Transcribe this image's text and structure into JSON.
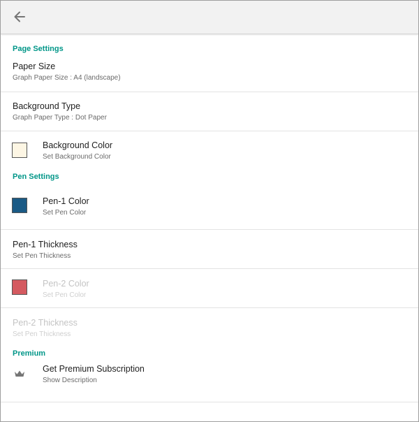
{
  "page_settings": {
    "header": "Page Settings",
    "paper_size": {
      "title": "Paper Size",
      "summary": "Graph Paper Size : A4 (landscape)"
    },
    "background_type": {
      "title": "Background Type",
      "summary": "Graph Paper Type : Dot Paper"
    },
    "background_color": {
      "title": "Background Color",
      "summary": "Set Background Color",
      "swatch": "#fdf6e4"
    }
  },
  "pen_settings": {
    "header": "Pen Settings",
    "pen1_color": {
      "title": "Pen-1 Color",
      "summary": "Set Pen Color",
      "swatch": "#1a5a85"
    },
    "pen1_thickness": {
      "title": "Pen-1 Thickness",
      "summary": "Set Pen Thickness"
    },
    "pen2_color": {
      "title": "Pen-2 Color",
      "summary": "Set Pen Color",
      "swatch": "#d45a60",
      "enabled": false
    },
    "pen2_thickness": {
      "title": "Pen-2 Thickness",
      "summary": "Set Pen Thickness",
      "enabled": false
    }
  },
  "premium": {
    "header": "Premium",
    "subscription": {
      "title": "Get Premium Subscription",
      "summary": "Show Description",
      "icon": "crown-icon"
    }
  },
  "toolbar": {
    "back_icon": "arrow-back-icon"
  },
  "colors": {
    "accent": "#009688",
    "toolbar_bg": "#f2f2f2"
  }
}
